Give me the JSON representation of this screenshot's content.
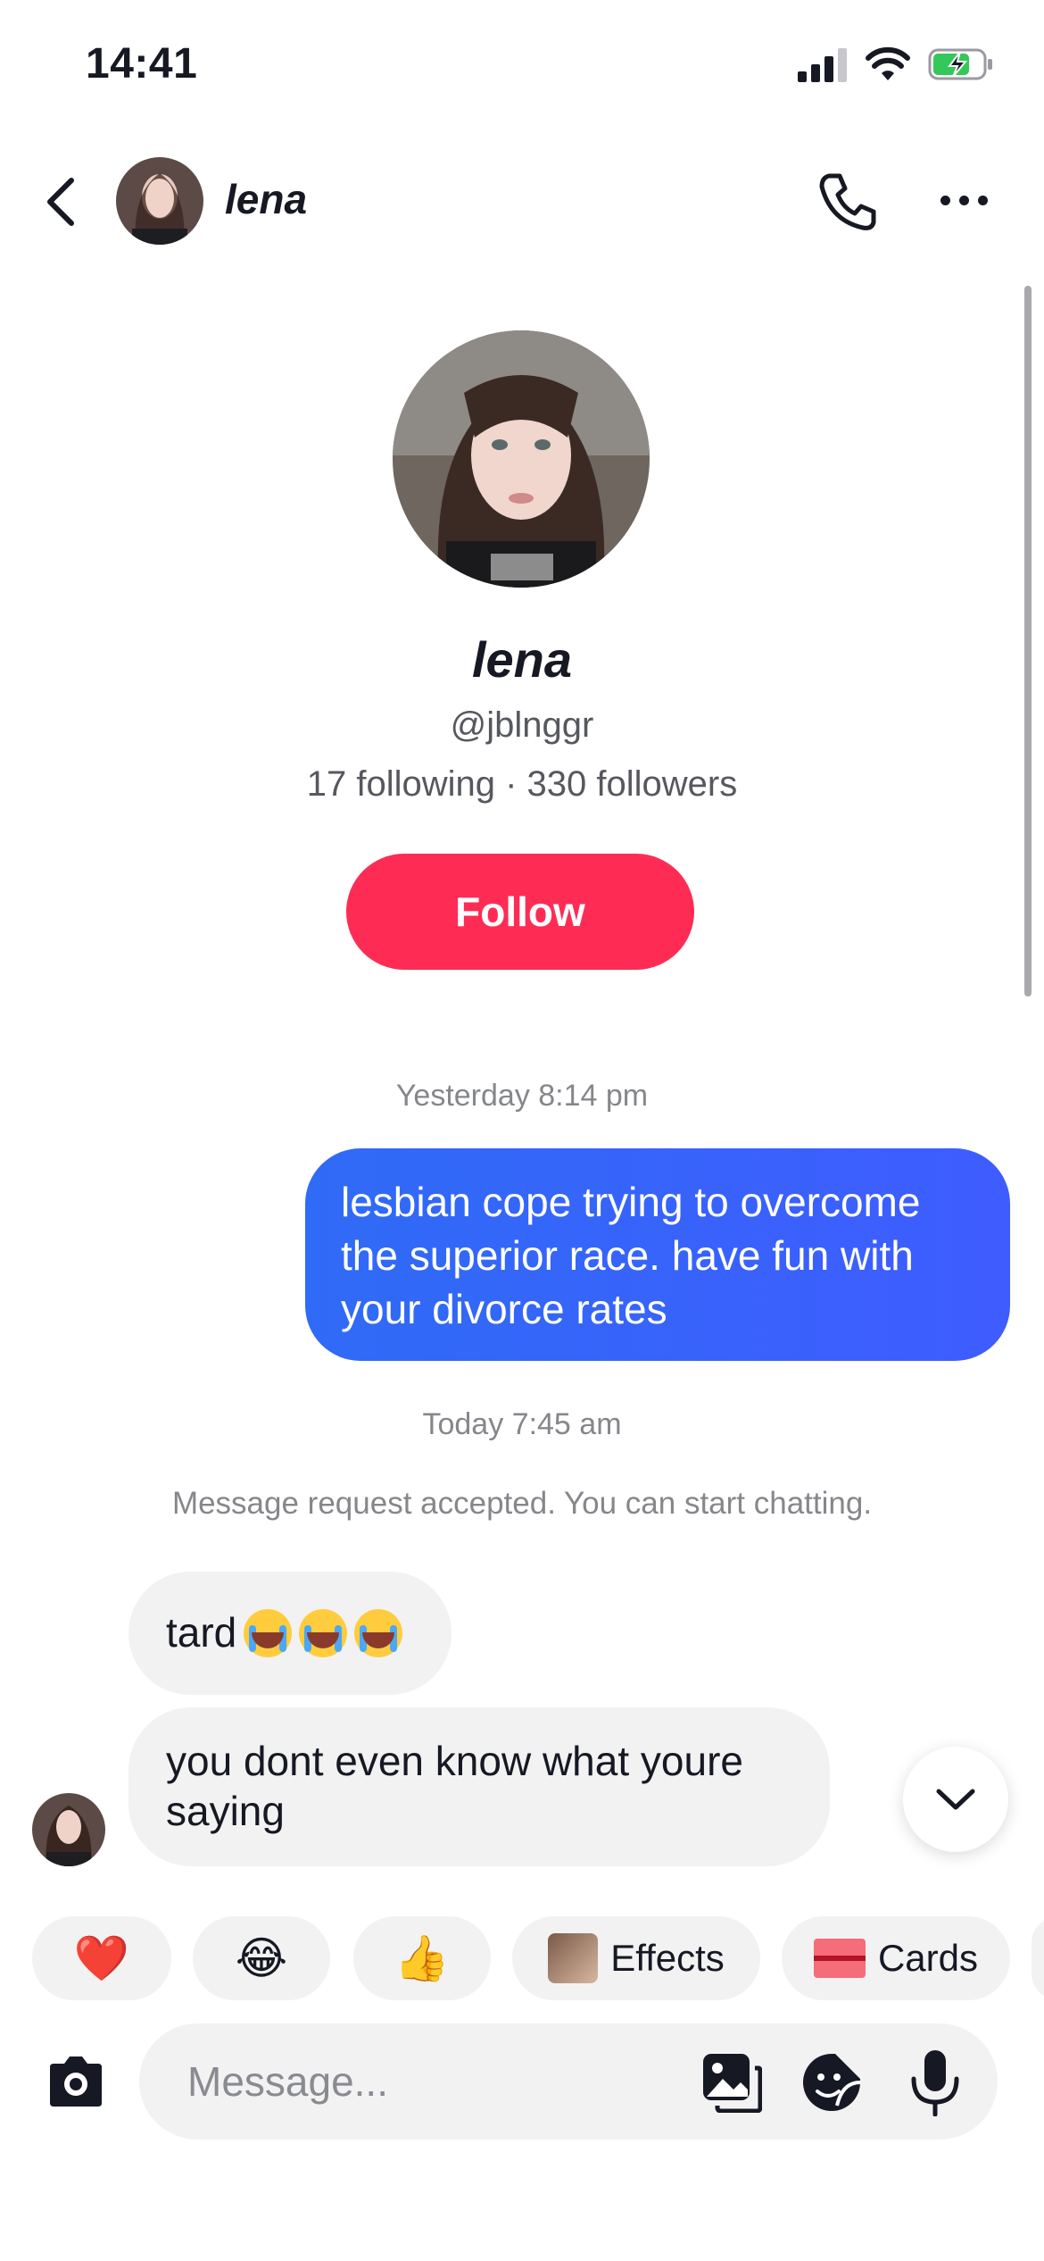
{
  "status_bar": {
    "time": "14:41"
  },
  "header": {
    "name": "lena",
    "back_icon": "chevron-left-icon",
    "call_icon": "phone-icon",
    "more_icon": "more-horizontal-icon"
  },
  "profile": {
    "name": "lena",
    "handle": "@jblnggr",
    "stats": "17 following · 330 followers",
    "follow_label": "Follow"
  },
  "messages": {
    "timestamp_1": "Yesterday 8:14 pm",
    "outgoing_1": "lesbian cope trying to overcome the superior race. have fun with your divorce rates",
    "timestamp_2": "Today 7:45 am",
    "system_note": "Message request accepted. You can start chatting.",
    "incoming_1_text": "tard",
    "incoming_1_emoji": [
      "😭",
      "😭",
      "😭"
    ],
    "incoming_2": "you dont even know what youre saying"
  },
  "quick_replies": {
    "heart": "❤️",
    "laugh": "😂",
    "thumbs": "👍",
    "effects_label": "Effects",
    "cards_label": "Cards"
  },
  "composer": {
    "placeholder": "Message..."
  },
  "colors": {
    "accent_red": "#fe2c55",
    "outgoing_blue": "#3a63f8",
    "bubble_gray": "#f2f2f3",
    "battery_green": "#34c759"
  }
}
